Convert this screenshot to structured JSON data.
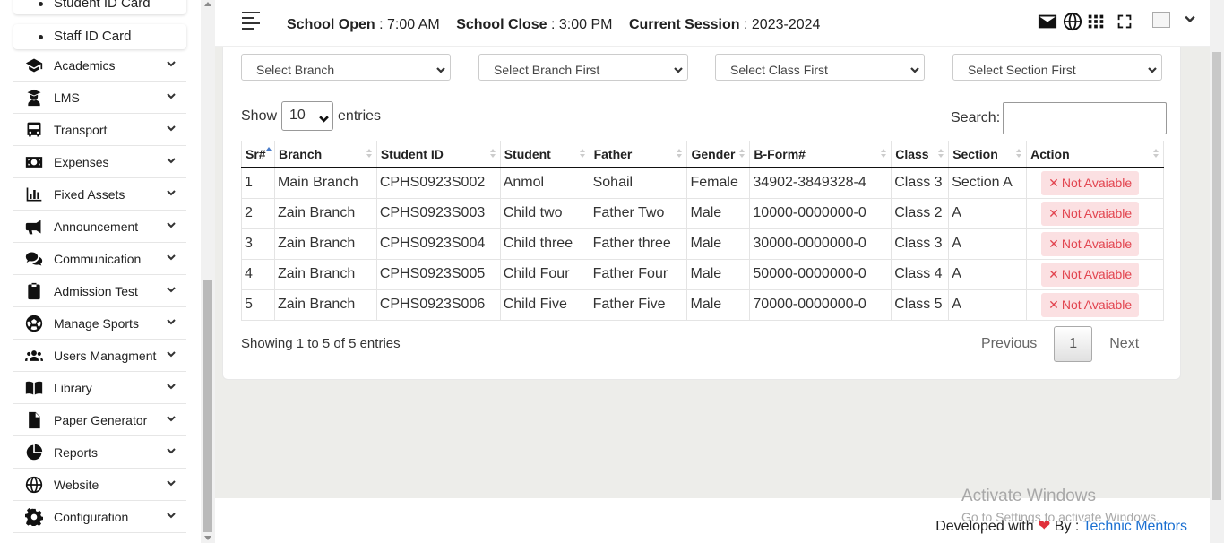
{
  "sidebar": {
    "sub_items": [
      "Student ID Card",
      "Staff ID Card"
    ],
    "items": [
      {
        "label": "Academics",
        "icon": "graduation-cap-icon"
      },
      {
        "label": "LMS",
        "icon": "user-graduate-icon"
      },
      {
        "label": "Transport",
        "icon": "bus-icon"
      },
      {
        "label": "Expenses",
        "icon": "money-bill-icon"
      },
      {
        "label": "Fixed Assets",
        "icon": "chart-bar-icon"
      },
      {
        "label": "Announcement",
        "icon": "bullhorn-icon"
      },
      {
        "label": "Communication",
        "icon": "comments-icon"
      },
      {
        "label": "Admission Test",
        "icon": "clipboard-icon"
      },
      {
        "label": "Manage Sports",
        "icon": "football-icon"
      },
      {
        "label": "Users Managment",
        "icon": "users-icon"
      },
      {
        "label": "Library",
        "icon": "book-open-icon"
      },
      {
        "label": "Paper Generator",
        "icon": "file-icon"
      },
      {
        "label": "Reports",
        "icon": "chart-pie-icon"
      },
      {
        "label": "Website",
        "icon": "globe-icon"
      },
      {
        "label": "Configuration",
        "icon": "gear-icon"
      }
    ]
  },
  "header": {
    "school_open_label": "School Open",
    "school_open_value": "7:00 AM",
    "school_close_label": "School Close",
    "school_close_value": "3:00 PM",
    "session_label": "Current Session",
    "session_value": "2023-2024",
    "separator": ":"
  },
  "filters": {
    "branch": "Select Branch",
    "branch_first": "Select Branch First",
    "class_first": "Select Class First",
    "section_first": "Select Section First"
  },
  "table_controls": {
    "show_label": "Show",
    "entries_value": "10",
    "entries_label": "entries",
    "search_label": "Search:"
  },
  "table": {
    "headers": [
      "Sr#",
      "Branch",
      "Student ID",
      "Student",
      "Father",
      "Gender",
      "B-Form#",
      "Class",
      "Section",
      "Action"
    ],
    "rows": [
      {
        "sr": "1",
        "branch": "Main Branch",
        "student_id": "CPHS0923S002",
        "student": "Anmol",
        "father": "Sohail",
        "gender": "Female",
        "bform": "34902-3849328-4",
        "class": "Class 3",
        "section": "Section A",
        "action": "Not Avaiable"
      },
      {
        "sr": "2",
        "branch": "Zain Branch",
        "student_id": "CPHS0923S003",
        "student": "Child two",
        "father": "Father Two",
        "gender": "Male",
        "bform": "10000-0000000-0",
        "class": "Class 2",
        "section": "A",
        "action": "Not Avaiable"
      },
      {
        "sr": "3",
        "branch": "Zain Branch",
        "student_id": "CPHS0923S004",
        "student": "Child three",
        "father": "Father three",
        "gender": "Male",
        "bform": "30000-0000000-0",
        "class": "Class 3",
        "section": "A",
        "action": "Not Avaiable"
      },
      {
        "sr": "4",
        "branch": "Zain Branch",
        "student_id": "CPHS0923S005",
        "student": "Child Four",
        "father": "Father Four",
        "gender": "Male",
        "bform": "50000-0000000-0",
        "class": "Class 4",
        "section": "A",
        "action": "Not Avaiable"
      },
      {
        "sr": "5",
        "branch": "Zain Branch",
        "student_id": "CPHS0923S006",
        "student": "Child Five",
        "father": "Father Five",
        "gender": "Male",
        "bform": "70000-0000000-0",
        "class": "Class 5",
        "section": "A",
        "action": "Not Avaiable"
      }
    ]
  },
  "pagination": {
    "info": "Showing 1 to 5 of 5 entries",
    "previous": "Previous",
    "current_page": "1",
    "next": "Next"
  },
  "watermark": {
    "title": "Activate Windows",
    "subtitle": "Go to Settings to activate Windows."
  },
  "footer": {
    "developed_with": "Developed with",
    "by": "By :",
    "company": "Technic Mentors"
  },
  "colors": {
    "not_available_bg": "#fbe0e2",
    "not_available_text": "#e2444f",
    "link": "#1a6fd1",
    "heart": "#e0303a"
  }
}
